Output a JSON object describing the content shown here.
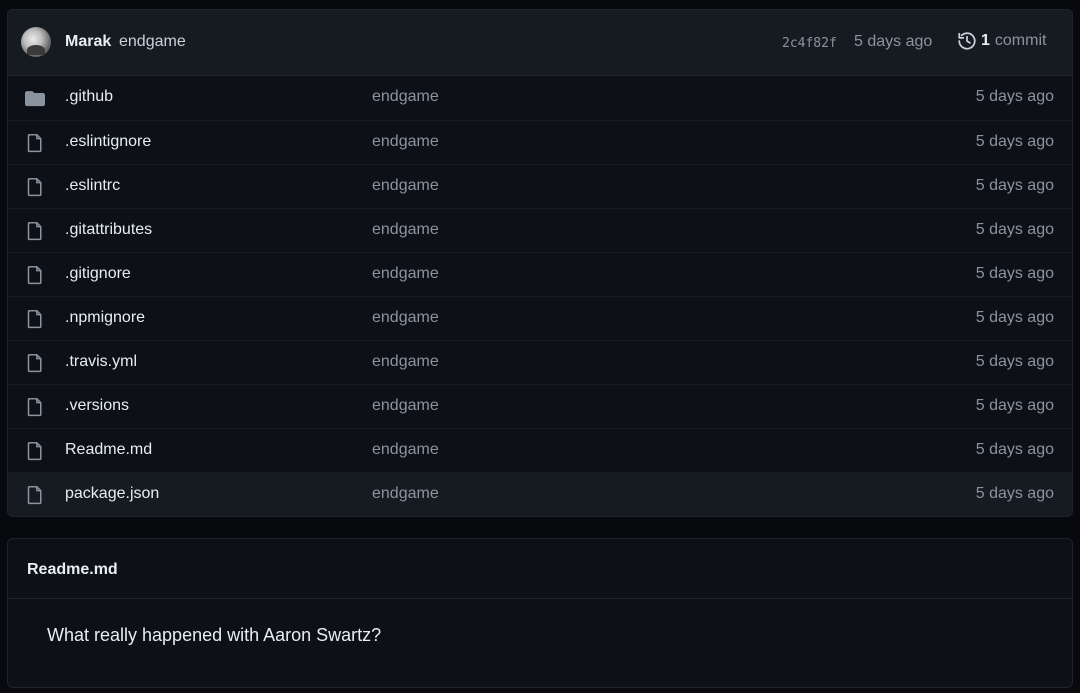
{
  "latest_commit": {
    "author": "Marak",
    "message": "endgame",
    "sha": "2c4f82f",
    "age": "5 days ago",
    "history_count": "1",
    "history_label": "commit"
  },
  "files": [
    {
      "name": ".github",
      "type": "folder",
      "icon": "folder-icon",
      "commit": "endgame",
      "age": "5 days ago"
    },
    {
      "name": ".eslintignore",
      "type": "file",
      "icon": "file-icon",
      "commit": "endgame",
      "age": "5 days ago"
    },
    {
      "name": ".eslintrc",
      "type": "file",
      "icon": "file-icon",
      "commit": "endgame",
      "age": "5 days ago"
    },
    {
      "name": ".gitattributes",
      "type": "file",
      "icon": "file-icon",
      "commit": "endgame",
      "age": "5 days ago"
    },
    {
      "name": ".gitignore",
      "type": "file",
      "icon": "file-icon",
      "commit": "endgame",
      "age": "5 days ago"
    },
    {
      "name": ".npmignore",
      "type": "file",
      "icon": "file-icon",
      "commit": "endgame",
      "age": "5 days ago"
    },
    {
      "name": ".travis.yml",
      "type": "file",
      "icon": "file-icon",
      "commit": "endgame",
      "age": "5 days ago"
    },
    {
      "name": ".versions",
      "type": "file",
      "icon": "file-icon",
      "commit": "endgame",
      "age": "5 days ago"
    },
    {
      "name": "Readme.md",
      "type": "file",
      "icon": "file-icon",
      "commit": "endgame",
      "age": "5 days ago"
    },
    {
      "name": "package.json",
      "type": "file",
      "icon": "file-icon",
      "commit": "endgame",
      "age": "5 days ago"
    }
  ],
  "readme": {
    "title": "Readme.md",
    "body": "What really happened with Aaron Swartz?"
  },
  "colors": {
    "background": "#07090d",
    "panel": "#0d1117",
    "header": "#161b22",
    "text": "#e6edf3",
    "muted": "#8b949e",
    "icon": "#8b949e"
  }
}
